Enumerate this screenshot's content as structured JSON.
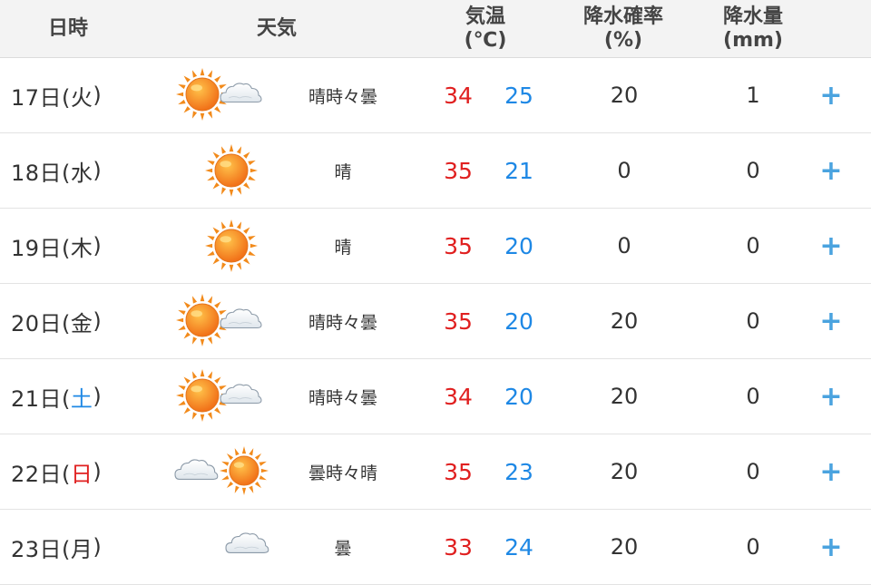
{
  "colors": {
    "max_temp": "#e02020",
    "min_temp": "#1e88e5",
    "plus": "#4aa3df",
    "sat": "#1e88e5",
    "sun": "#e02020"
  },
  "header": {
    "date": "日時",
    "weather": "天気",
    "temp_line1": "気温",
    "temp_line2": "(℃)",
    "prob_line1": "降水確率",
    "prob_line2": "(%)",
    "amount_line1": "降水量",
    "amount_line2": "(mm)"
  },
  "rows": [
    {
      "day": "17日(",
      "dow": "火",
      "close": ")",
      "dow_color": "",
      "icon": "sun-cloud-icon",
      "weather": "晴時々曇",
      "max": "34",
      "min": "25",
      "prob": "20",
      "amount": "1",
      "expand": "+"
    },
    {
      "day": "18日(",
      "dow": "水",
      "close": ")",
      "dow_color": "",
      "icon": "sun-icon",
      "weather": "晴",
      "max": "35",
      "min": "21",
      "prob": "0",
      "amount": "0",
      "expand": "+"
    },
    {
      "day": "19日(",
      "dow": "木",
      "close": ")",
      "dow_color": "",
      "icon": "sun-icon",
      "weather": "晴",
      "max": "35",
      "min": "20",
      "prob": "0",
      "amount": "0",
      "expand": "+"
    },
    {
      "day": "20日(",
      "dow": "金",
      "close": ")",
      "dow_color": "",
      "icon": "sun-cloud-icon",
      "weather": "晴時々曇",
      "max": "35",
      "min": "20",
      "prob": "20",
      "amount": "0",
      "expand": "+"
    },
    {
      "day": "21日(",
      "dow": "土",
      "close": ")",
      "dow_color": "#1e88e5",
      "icon": "sun-cloud-icon",
      "weather": "晴時々曇",
      "max": "34",
      "min": "20",
      "prob": "20",
      "amount": "0",
      "expand": "+"
    },
    {
      "day": "22日(",
      "dow": "日",
      "close": ")",
      "dow_color": "#e02020",
      "icon": "cloud-sun-icon",
      "weather": "曇時々晴",
      "max": "35",
      "min": "23",
      "prob": "20",
      "amount": "0",
      "expand": "+"
    },
    {
      "day": "23日(",
      "dow": "月",
      "close": ")",
      "dow_color": "",
      "icon": "cloud-icon",
      "weather": "曇",
      "max": "33",
      "min": "24",
      "prob": "20",
      "amount": "0",
      "expand": "+"
    }
  ]
}
